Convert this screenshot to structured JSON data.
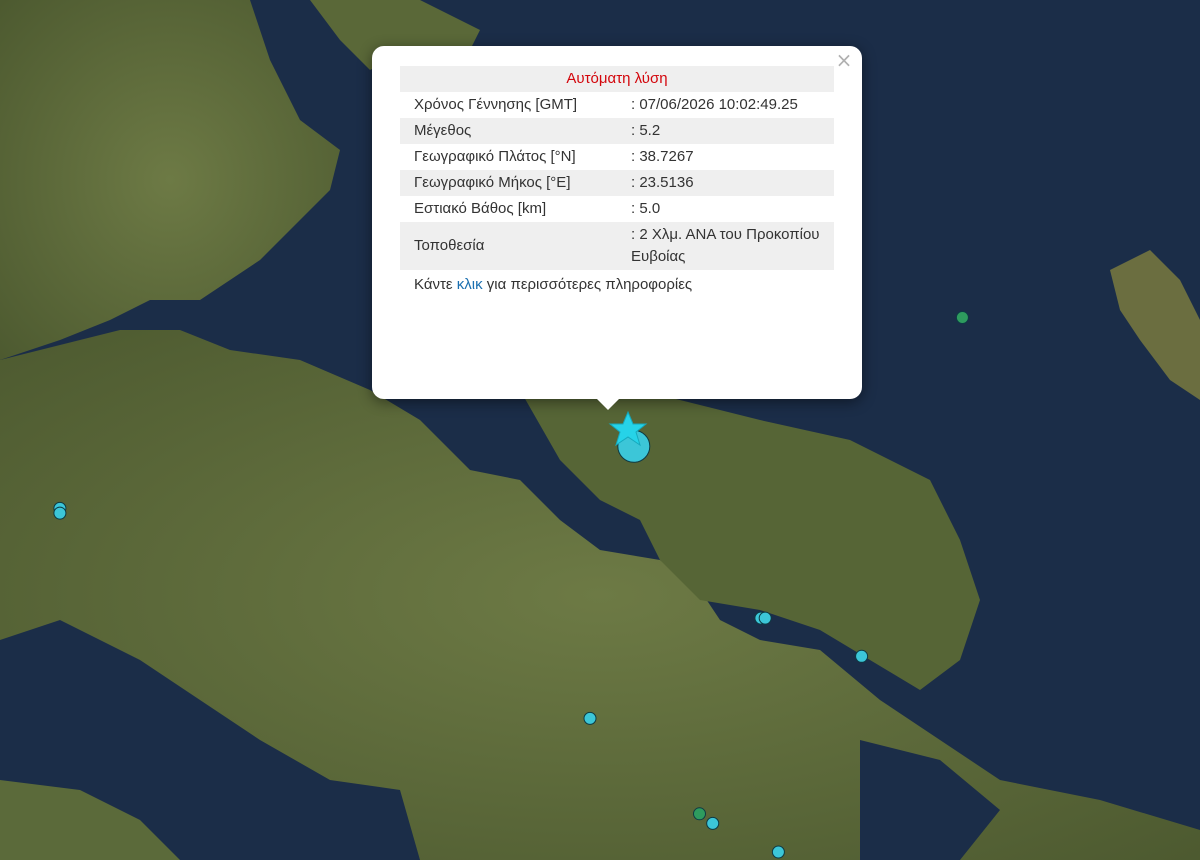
{
  "popup": {
    "title": "Αυτόματη λύση",
    "close_symbol": "×",
    "rows": [
      {
        "label": "Χρόνος Γέννησης [GMT]",
        "value": ": 07/06/2026 10:02:49.25"
      },
      {
        "label": "Μέγεθος",
        "value": ": 5.2"
      },
      {
        "label": "Γεωγραφικό Πλάτος [°N]",
        "value": ": 38.7267"
      },
      {
        "label": "Γεωγραφικό Μήκος [°E]",
        "value": ": 23.5136"
      },
      {
        "label": "Εστιακό Βάθος [km]",
        "value": ": 5.0"
      },
      {
        "label": "Τοποθεσία",
        "value": ": 2 Χλμ. ΑΝΑ του Προκοπίου Ευβοίας"
      }
    ],
    "more_prefix": "Κάντε ",
    "more_link": "κλικ",
    "more_suffix": " για περισσότερες πληροφορίες"
  },
  "map": {
    "sea_color": "#1b2d48",
    "land_color": "#5f6a3c",
    "epicenter": {
      "icon": "star-icon",
      "color": "#26d3e8"
    },
    "markers": [
      {
        "lat": 39.37,
        "lon": 23.58,
        "type": "cyan"
      },
      {
        "lat": 38.97,
        "lon": 24.16,
        "type": "green"
      },
      {
        "lat": 38.57,
        "lon": 22.1,
        "type": "cyan"
      },
      {
        "lat": 38.56,
        "lon": 22.1,
        "type": "cyan"
      },
      {
        "lat": 38.7,
        "lon": 23.41,
        "type": "cyan-large"
      },
      {
        "lat": 38.34,
        "lon": 23.7,
        "type": "cyan"
      },
      {
        "lat": 38.34,
        "lon": 23.71,
        "type": "cyan"
      },
      {
        "lat": 38.26,
        "lon": 23.93,
        "type": "cyan"
      },
      {
        "lat": 38.13,
        "lon": 23.31,
        "type": "cyan"
      },
      {
        "lat": 37.93,
        "lon": 23.56,
        "type": "green"
      },
      {
        "lat": 37.91,
        "lon": 23.59,
        "type": "cyan"
      },
      {
        "lat": 37.85,
        "lon": 23.74,
        "type": "cyan"
      }
    ],
    "marker_colors": {
      "cyan": "#3cc6d8",
      "cyan-large": "#3cc6d8",
      "green": "#2e9b5e"
    }
  }
}
